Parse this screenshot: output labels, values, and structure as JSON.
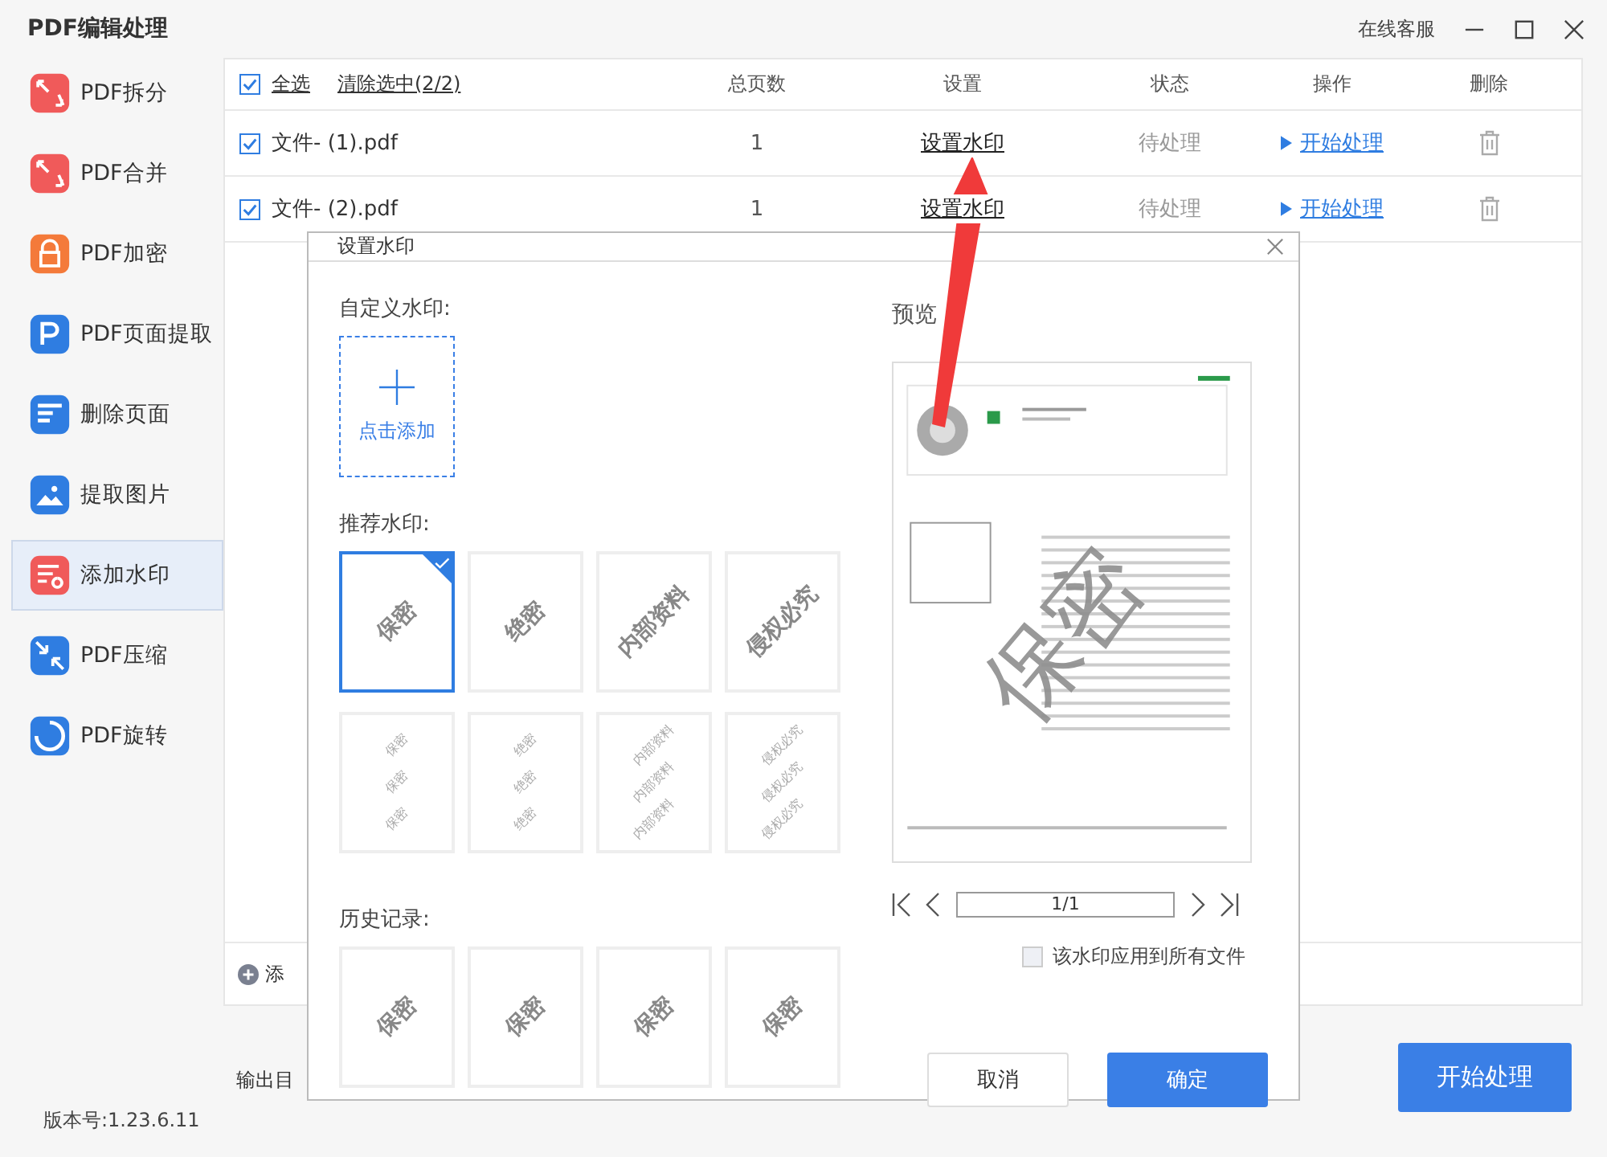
{
  "window": {
    "title": "PDF编辑处理",
    "support": "在线客服"
  },
  "sidebar": {
    "items": [
      {
        "label": "PDF拆分",
        "kind": "split",
        "color": "#f05a5a",
        "selected": false
      },
      {
        "label": "PDF合并",
        "kind": "merge",
        "color": "#f05a5a",
        "selected": false
      },
      {
        "label": "PDF加密",
        "kind": "lock",
        "color": "#f47a3a",
        "selected": false
      },
      {
        "label": "PDF页面提取",
        "kind": "page",
        "color": "#2f7de1",
        "selected": false
      },
      {
        "label": "删除页面",
        "kind": "delete",
        "color": "#2f7de1",
        "selected": false
      },
      {
        "label": "提取图片",
        "kind": "image",
        "color": "#2f7de1",
        "selected": false
      },
      {
        "label": "添加水印",
        "kind": "watermark",
        "color": "#f05a5a",
        "selected": true
      },
      {
        "label": "PDF压缩",
        "kind": "compress",
        "color": "#2f7de1",
        "selected": false
      },
      {
        "label": "PDF旋转",
        "kind": "rotate",
        "color": "#2f7de1",
        "selected": false
      }
    ]
  },
  "table": {
    "select_all": {
      "label": "全选",
      "checked": true
    },
    "clear": "清除选中(2/2)",
    "columns": [
      "总页数",
      "设置",
      "状态",
      "操作",
      "删除"
    ],
    "rows": [
      {
        "name": "文件- (1).pdf",
        "checked": true,
        "pages": "1",
        "setting": "设置水印",
        "status": "待处理",
        "action": "开始处理"
      },
      {
        "name": "文件- (2).pdf",
        "checked": true,
        "pages": "1",
        "setting": "设置水印",
        "status": "待处理",
        "action": "开始处理"
      }
    ],
    "add_label": "添"
  },
  "output_label": "输出目",
  "start_button": "开始处理",
  "version": "版本号:1.23.6.11",
  "dialog": {
    "title": "设置水印",
    "custom_label": "自定义水印:",
    "add_text": "点击添加",
    "recommended_label": "推荐水印:",
    "recommended": [
      {
        "text": "保密",
        "selected": true
      },
      {
        "text": "绝密",
        "selected": false
      },
      {
        "text": "内部资料",
        "selected": false
      },
      {
        "text": "侵权必究",
        "selected": false
      }
    ],
    "patterns": [
      {
        "texts": [
          "保密",
          "保密",
          "保密"
        ],
        "selected": false
      },
      {
        "texts": [
          "绝密",
          "绝密",
          "绝密"
        ],
        "selected": false
      },
      {
        "texts": [
          "内部资料",
          "内部资料",
          "内部资料"
        ],
        "selected": false
      },
      {
        "texts": [
          "侵权必究",
          "侵权必究",
          "侵权必究"
        ],
        "selected": false
      }
    ],
    "history_label": "历史记录:",
    "history": [
      "保密",
      "保密",
      "保密",
      "保密"
    ],
    "preview_label": "预览",
    "preview_watermark": "保密",
    "page_indicator": "1/1",
    "apply_all": {
      "label": "该水印应用到所有文件",
      "checked": false
    },
    "cancel": "取消",
    "confirm": "确定"
  }
}
